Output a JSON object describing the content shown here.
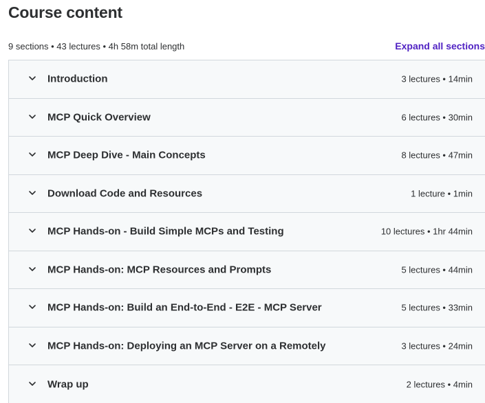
{
  "header": {
    "title": "Course content",
    "summary": "9 sections • 43 lectures • 4h 58m total length",
    "expand_label": "Expand all sections"
  },
  "icons": {
    "section_toggle": "chevron-down-icon"
  },
  "colors": {
    "accent": "#5022c3",
    "section_bg": "#f7f9fa",
    "border": "#d1d7dc"
  },
  "sections": [
    {
      "title": "Introduction",
      "meta": "3 lectures • 14min"
    },
    {
      "title": "MCP Quick Overview",
      "meta": "6 lectures • 30min"
    },
    {
      "title": "MCP Deep Dive - Main Concepts",
      "meta": "8 lectures • 47min"
    },
    {
      "title": "Download Code and Resources",
      "meta": "1 lecture • 1min"
    },
    {
      "title": "MCP Hands-on - Build Simple MCPs and Testing",
      "meta": "10 lectures • 1hr 44min"
    },
    {
      "title": "MCP Hands-on: MCP Resources and Prompts",
      "meta": "5 lectures • 44min"
    },
    {
      "title": "MCP Hands-on: Build an End-to-End - E2E - MCP Server",
      "meta": "5 lectures • 33min"
    },
    {
      "title": "MCP Hands-on: Deploying an MCP Server on a Remotely",
      "meta": "3 lectures • 24min"
    },
    {
      "title": "Wrap up",
      "meta": "2 lectures • 4min"
    }
  ]
}
